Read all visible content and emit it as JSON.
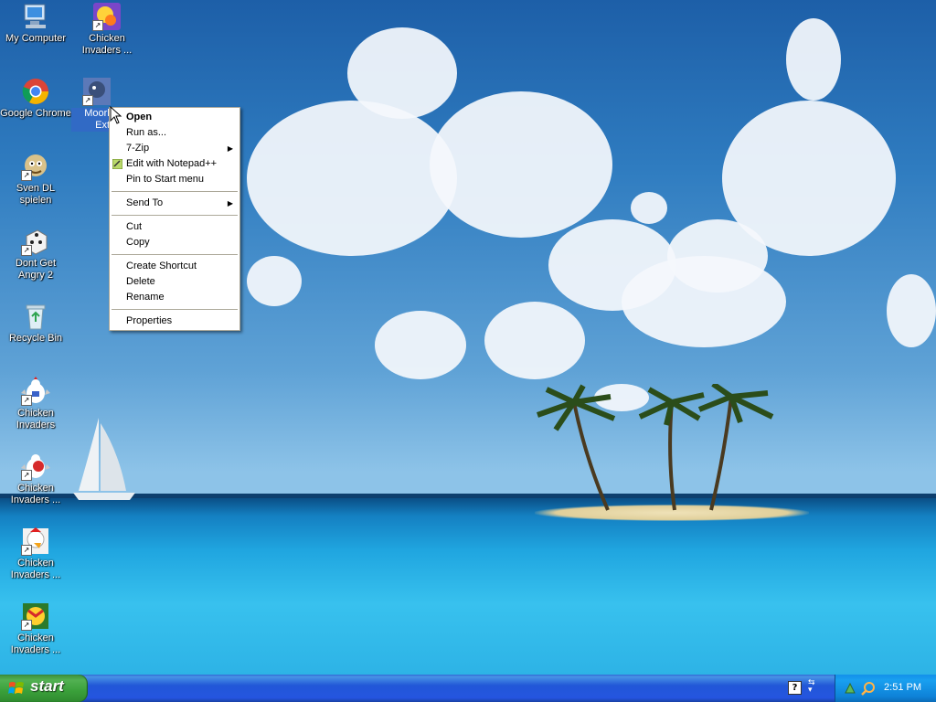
{
  "desktop_icons": [
    {
      "name": "my-computer",
      "label": "My Computer"
    },
    {
      "name": "chicken-invaders-top",
      "label": "Chicken\nInvaders ..."
    },
    {
      "name": "google-chrome",
      "label": "Google Chrome"
    },
    {
      "name": "moorhuhn-extra",
      "label": "Moorhuhn Extra"
    },
    {
      "name": "sven-dl-spielen",
      "label": "Sven DL\nspielen"
    },
    {
      "name": "dont-get-angry-2",
      "label": "Dont Get\nAngry 2"
    },
    {
      "name": "recycle-bin",
      "label": "Recycle Bin"
    },
    {
      "name": "chicken-invaders-1",
      "label": "Chicken\nInvaders"
    },
    {
      "name": "chicken-invaders-2",
      "label": "Chicken\nInvaders ..."
    },
    {
      "name": "chicken-invaders-3",
      "label": "Chicken\nInvaders ..."
    },
    {
      "name": "chicken-invaders-4",
      "label": "Chicken\nInvaders ..."
    }
  ],
  "context_menu": {
    "open": "Open",
    "run_as": "Run as...",
    "seven_zip": "7-Zip",
    "edit_notepad": "Edit with Notepad++",
    "pin_start": "Pin to Start menu",
    "send_to": "Send To",
    "cut": "Cut",
    "copy": "Copy",
    "create_shortcut": "Create Shortcut",
    "delete": "Delete",
    "rename": "Rename",
    "properties": "Properties",
    "submenu_arrow": "▶"
  },
  "taskbar": {
    "start_label": "start",
    "clock": "2:51 PM",
    "help_icon": "?",
    "colors": {
      "start_green": "#3aa03a",
      "taskbar_blue": "#2555e0",
      "tray_blue": "#0e82d8"
    }
  },
  "icon_names": [
    "computer-icon",
    "chrome-icon",
    "recycle-bin-icon",
    "chicken-icon",
    "game-icon",
    "notepad-plus-icon",
    "windows-logo-icon"
  ]
}
